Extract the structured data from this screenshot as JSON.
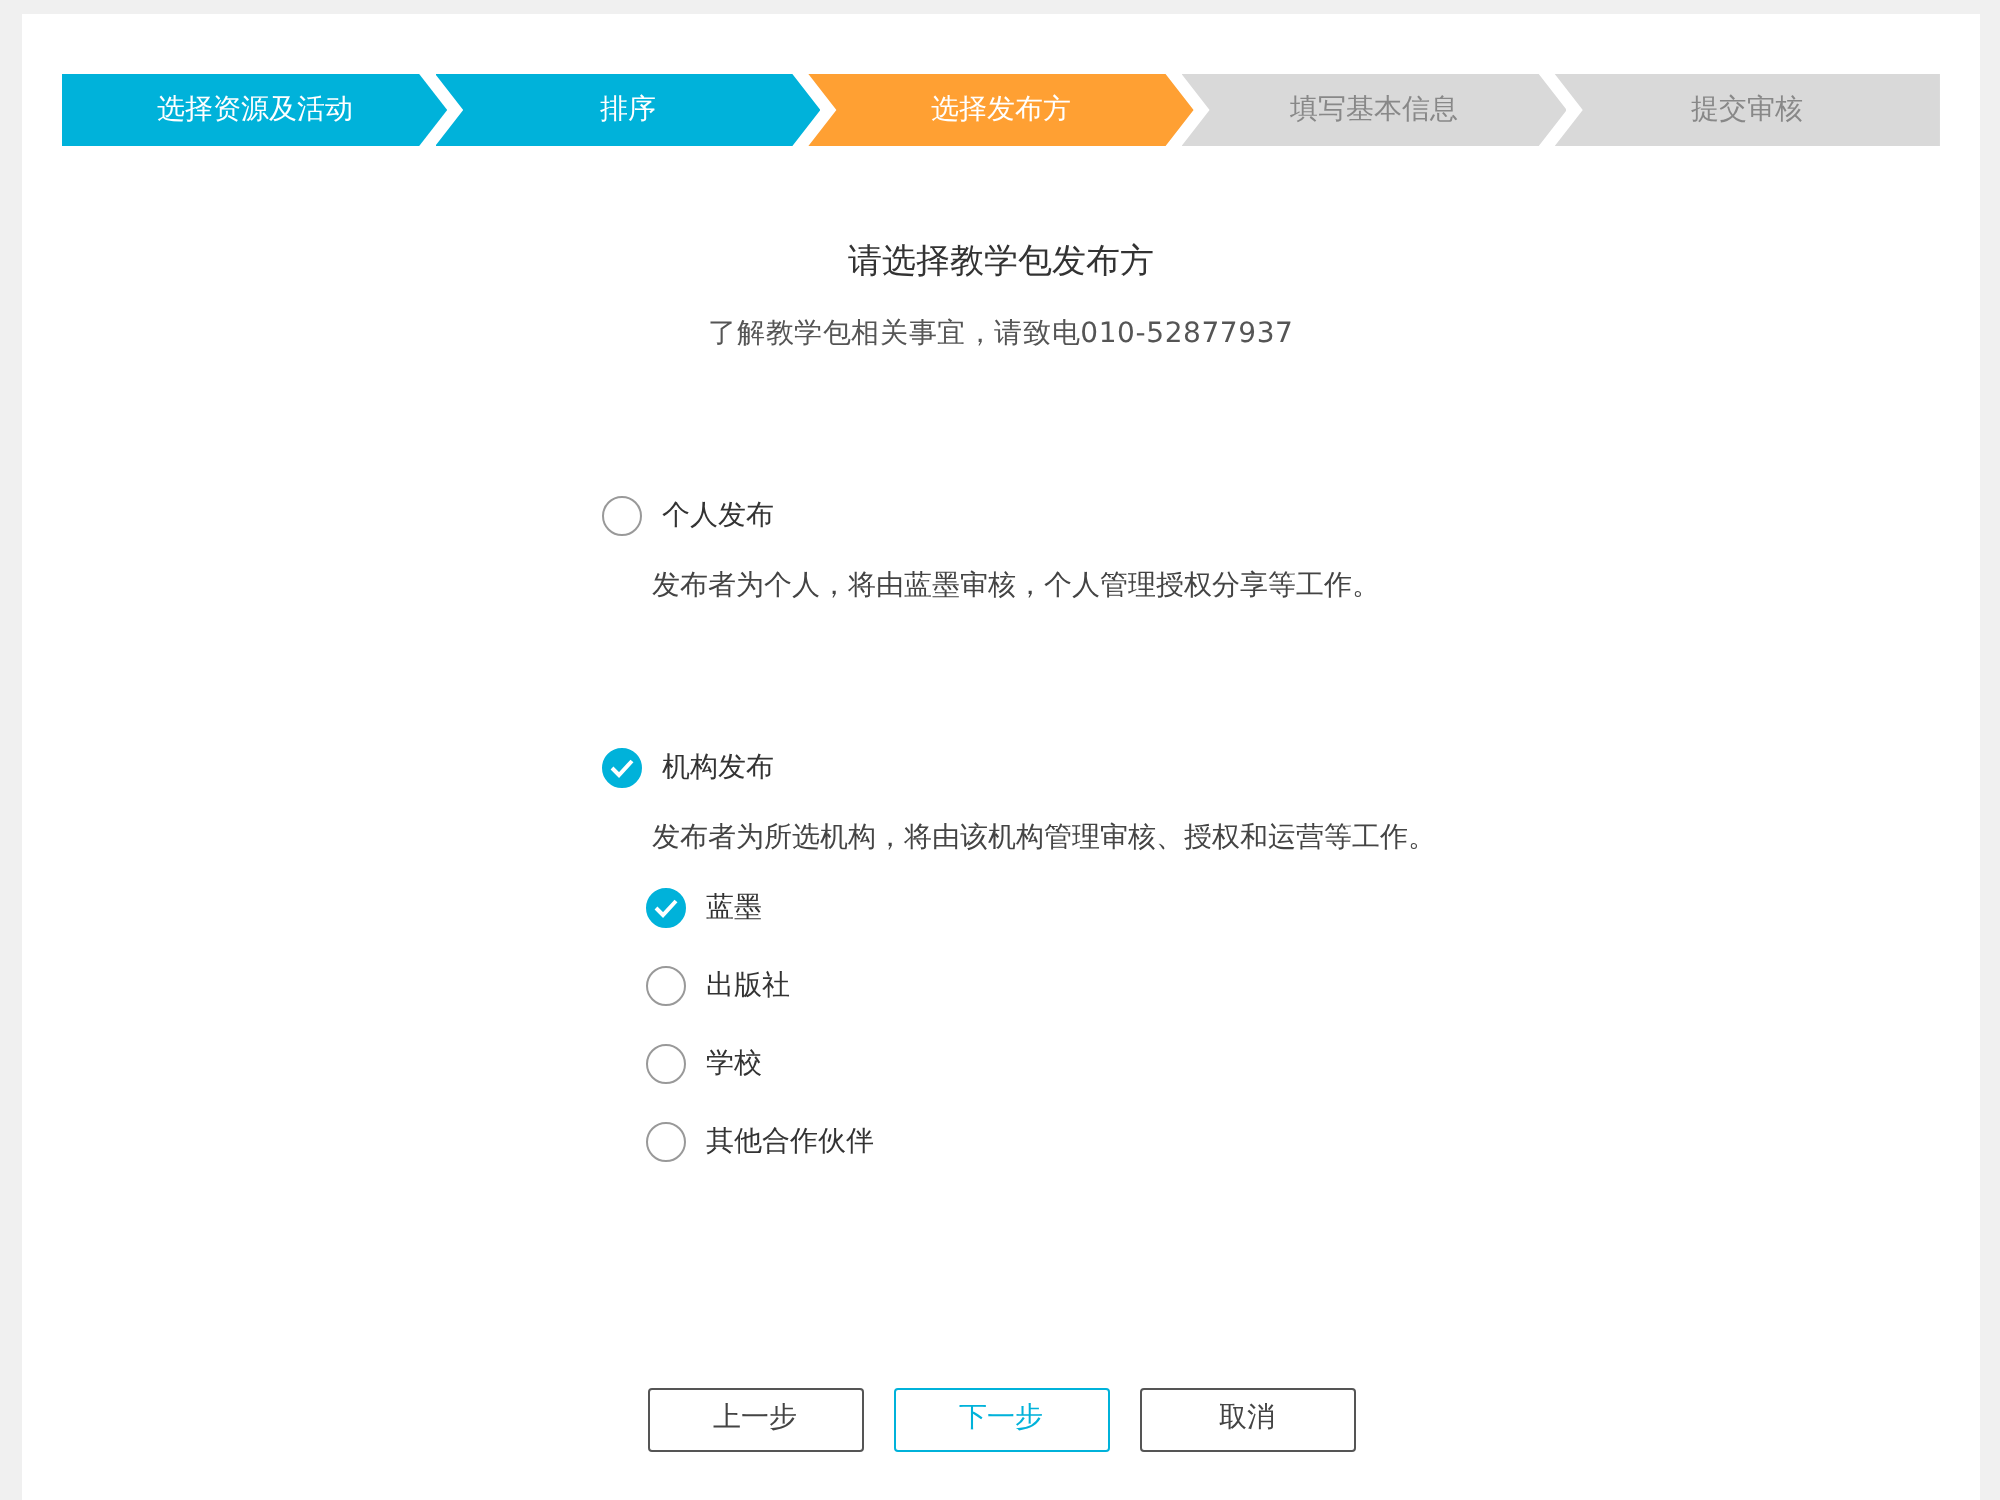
{
  "steps": [
    {
      "label": "选择资源及活动",
      "kind": "done"
    },
    {
      "label": "排序",
      "kind": "done"
    },
    {
      "label": "选择发布方",
      "kind": "current"
    },
    {
      "label": "填写基本信息",
      "kind": "todo"
    },
    {
      "label": "提交审核",
      "kind": "todo"
    }
  ],
  "heading": "请选择教学包发布方",
  "subheading": "了解教学包相关事宜，请致电010-52877937",
  "options": [
    {
      "label": "个人发布",
      "selected": false,
      "description": "发布者为个人，将由蓝墨审核，个人管理授权分享等工作。"
    },
    {
      "label": "机构发布",
      "selected": true,
      "description": "发布者为所选机构，将由该机构管理审核、授权和运营等工作。",
      "children": [
        {
          "label": "蓝墨",
          "selected": true
        },
        {
          "label": "出版社",
          "selected": false
        },
        {
          "label": "学校",
          "selected": false
        },
        {
          "label": "其他合作伙伴",
          "selected": false
        }
      ]
    }
  ],
  "buttons": [
    {
      "label": "上一步",
      "kind": "default"
    },
    {
      "label": "下一步",
      "kind": "primary"
    },
    {
      "label": "取消",
      "kind": "default"
    }
  ]
}
